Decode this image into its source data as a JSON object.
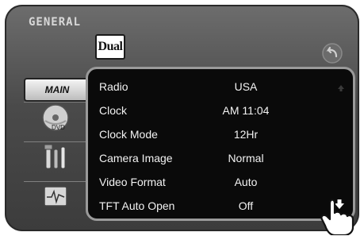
{
  "header": {
    "title": "GENERAL",
    "brand": "Dual"
  },
  "tabs": [
    {
      "label": "MAIN",
      "active": true
    },
    {
      "icon": "disc-dvd-icon"
    },
    {
      "icon": "tools-icon"
    },
    {
      "icon": "waveform-icon"
    }
  ],
  "settings": [
    {
      "label": "Radio",
      "value": "USA"
    },
    {
      "label": "Clock",
      "value": "AM 11:04"
    },
    {
      "label": "Clock Mode",
      "value": "12Hr"
    },
    {
      "label": "Camera Image",
      "value": "Normal"
    },
    {
      "label": "Video Format",
      "value": "Auto"
    },
    {
      "label": "TFT Auto Open",
      "value": "Off"
    }
  ],
  "colors": {
    "bezel": "#4a4a4a",
    "screen": "#0a0a0a",
    "text": "#f2f2f2"
  }
}
